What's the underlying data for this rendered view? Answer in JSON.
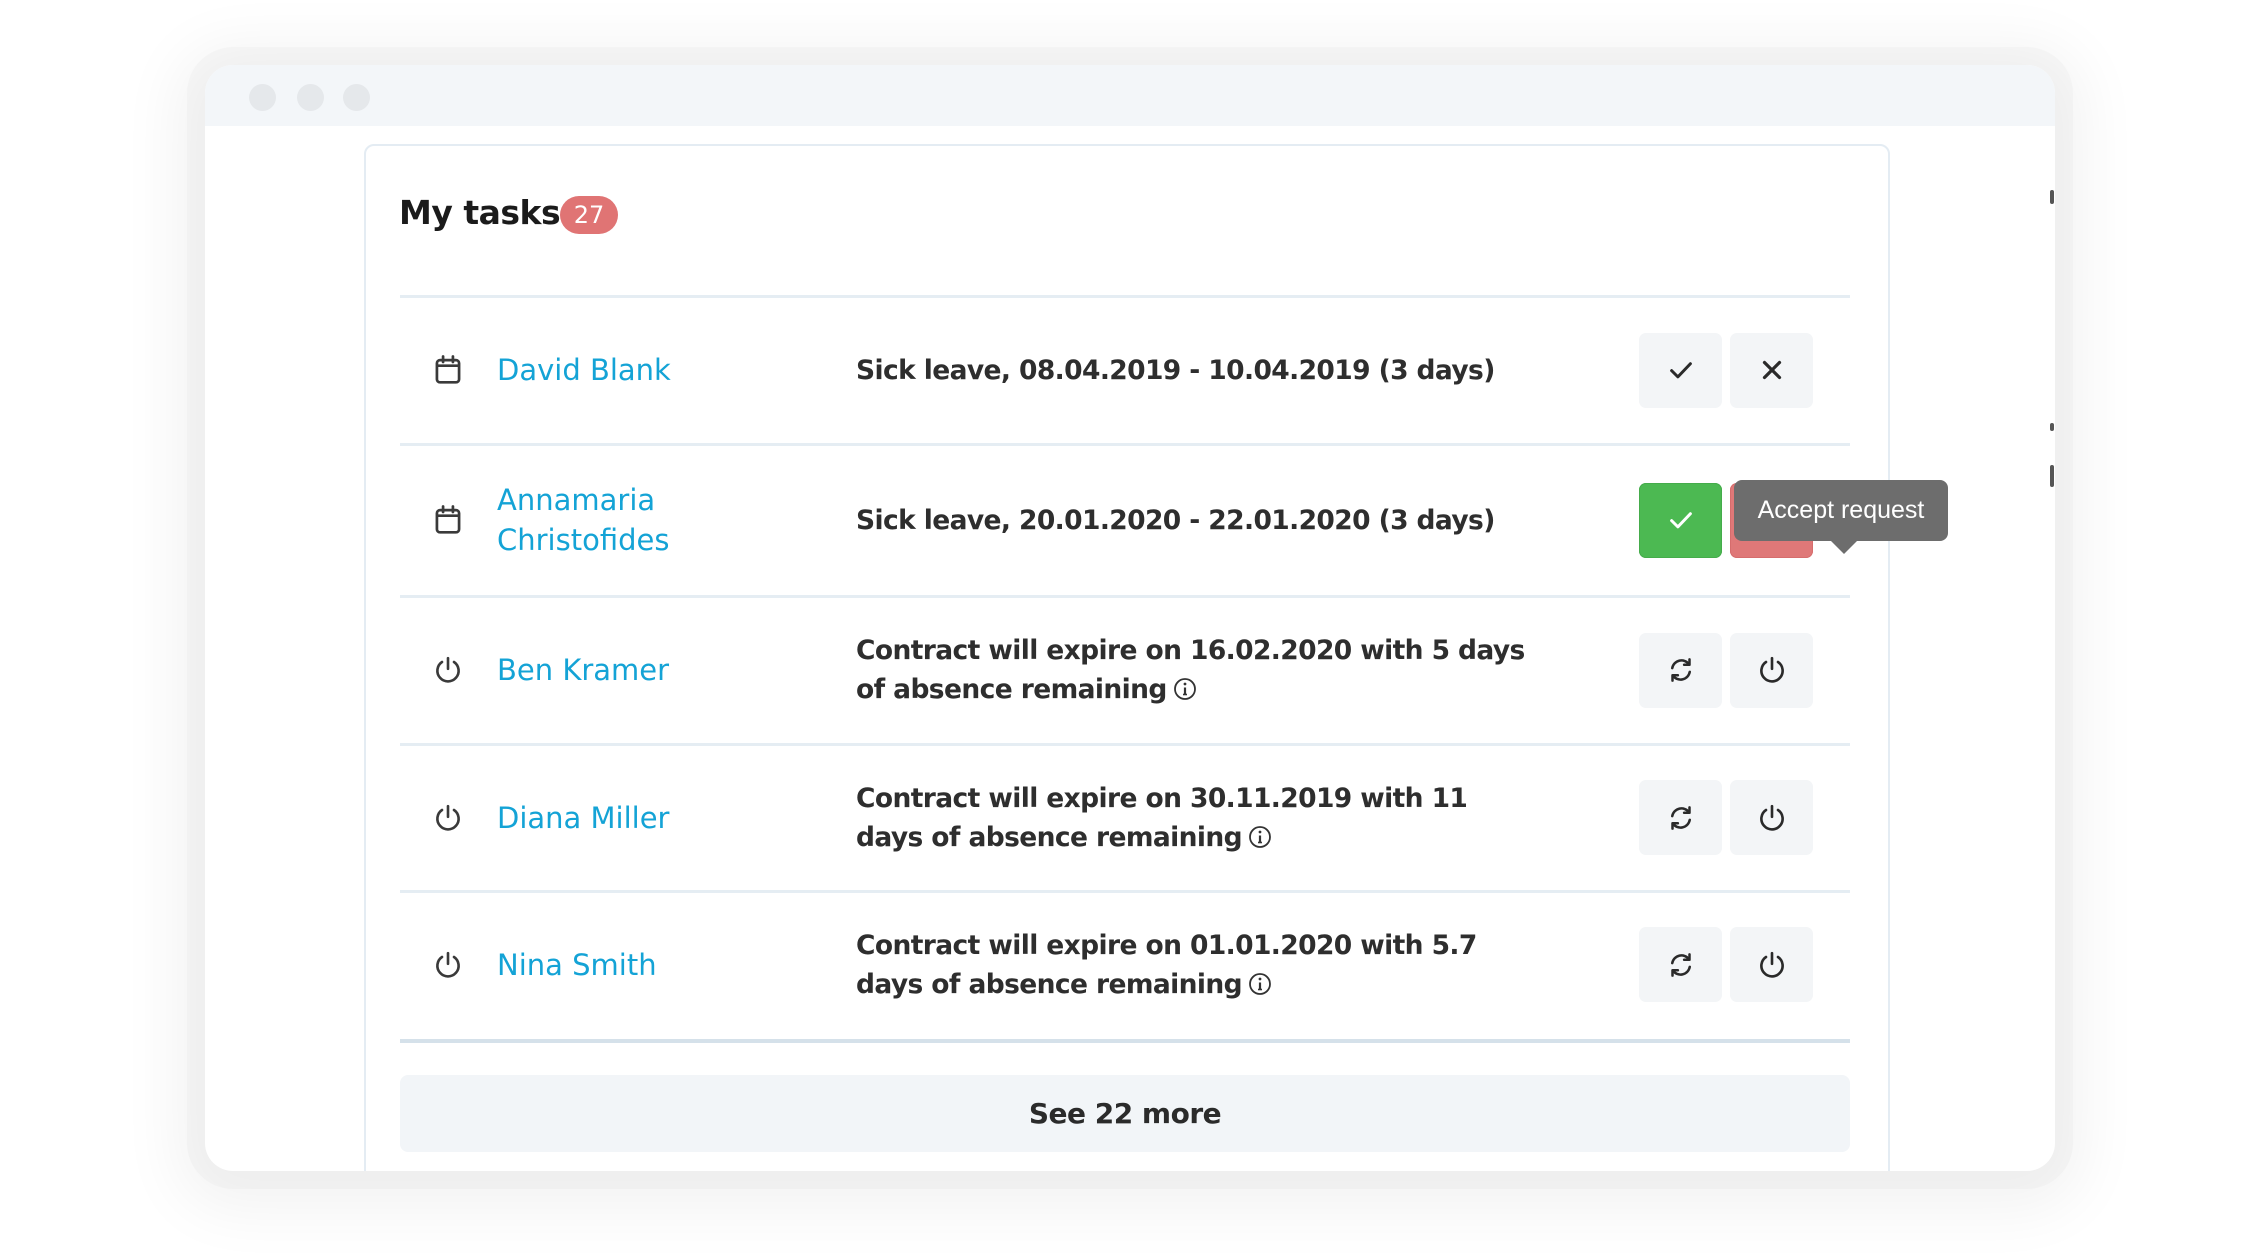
{
  "window": {
    "controls": [
      "window-dot-1",
      "window-dot-2",
      "window-dot-3"
    ]
  },
  "tasks": {
    "title": "My tasks",
    "count": "27",
    "rows": [
      {
        "icon": "calendar-icon",
        "name": "David Blank",
        "description": "Sick leave, 08.04.2019 - 10.04.2019 (3 days)",
        "info": false,
        "actions": [
          {
            "icon": "check-icon",
            "label": "Accept request",
            "state": "default"
          },
          {
            "icon": "close-icon",
            "label": "Decline request",
            "state": "default"
          }
        ]
      },
      {
        "icon": "calendar-icon",
        "name": "Annamaria Christofides",
        "description": "Sick leave, 20.01.2020 - 22.01.2020 (3 days)",
        "info": false,
        "actions": [
          {
            "icon": "check-icon",
            "label": "Accept request",
            "state": "active-accept"
          },
          {
            "icon": "close-icon",
            "label": "Decline request",
            "state": "active-reject"
          }
        ]
      },
      {
        "icon": "power-icon",
        "name": "Ben Kramer",
        "description": "Contract will expire on 16.02.2020 with 5 days of absence remaining",
        "info": true,
        "actions": [
          {
            "icon": "refresh-icon",
            "label": "Renew contract",
            "state": "default"
          },
          {
            "icon": "power-icon",
            "label": "End contract",
            "state": "default"
          }
        ]
      },
      {
        "icon": "power-icon",
        "name": "Diana Miller",
        "description": "Contract will expire on 30.11.2019 with 11 days of absence remaining",
        "info": true,
        "actions": [
          {
            "icon": "refresh-icon",
            "label": "Renew contract",
            "state": "default"
          },
          {
            "icon": "power-icon",
            "label": "End contract",
            "state": "default"
          }
        ]
      },
      {
        "icon": "power-icon",
        "name": "Nina Smith",
        "description": "Contract will expire on 01.01.2020 with 5.7 days of absence remaining",
        "info": true,
        "actions": [
          {
            "icon": "refresh-icon",
            "label": "Renew contract",
            "state": "default"
          },
          {
            "icon": "power-icon",
            "label": "End contract",
            "state": "default"
          }
        ]
      }
    ],
    "tooltip": "Accept request",
    "see_more": "See 22 more"
  },
  "colors": {
    "link": "#14a3d6",
    "badge": "#e07474",
    "accept": "#4cb952",
    "reject": "#df7878",
    "tooltip": "#6d6d6d"
  }
}
